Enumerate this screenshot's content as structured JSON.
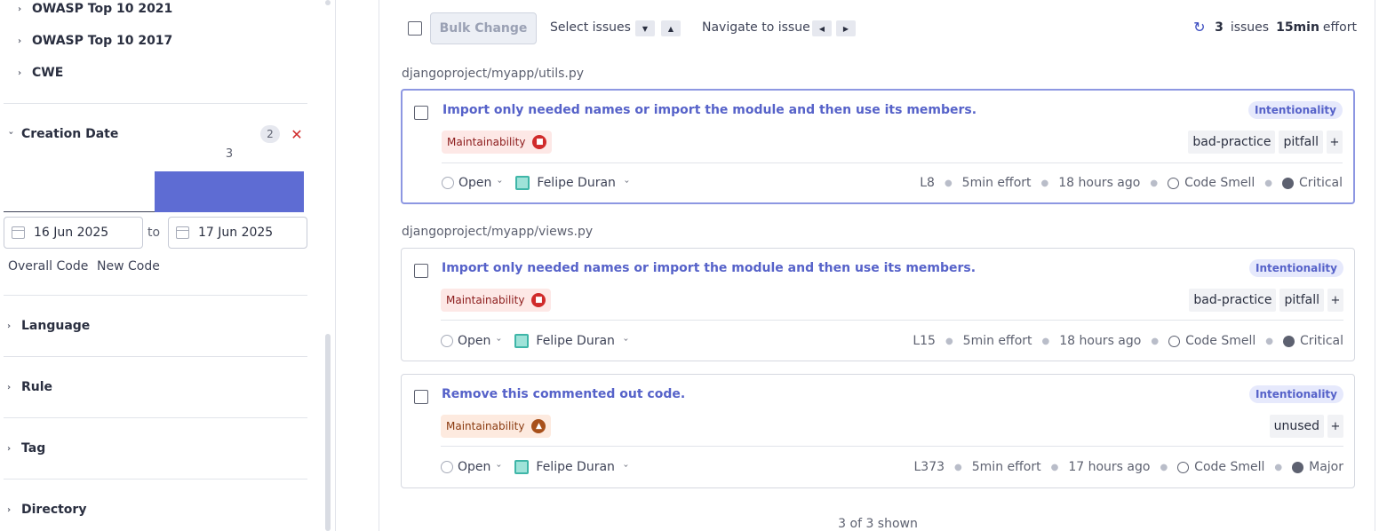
{
  "sidebar": {
    "standards": [
      "OWASP Top 10 2021",
      "OWASP Top 10 2017",
      "CWE"
    ],
    "creation_date": {
      "title": "Creation Date",
      "count": "2",
      "bar_value": "3",
      "from": "16 Jun 2025",
      "to_label": "to",
      "to": "17 Jun 2025",
      "overall_code": "Overall Code",
      "new_code": "New Code"
    },
    "facets": [
      "Language",
      "Rule",
      "Tag",
      "Directory"
    ]
  },
  "toolbar": {
    "bulk_change": "Bulk Change",
    "select_issues": "Select issues",
    "navigate": "Navigate to issue",
    "issues_count": "3",
    "issues_label": "issues",
    "effort_value": "15min",
    "effort_label": "effort"
  },
  "groups": [
    {
      "path": "djangoproject/myapp/utils.py",
      "issues": [
        {
          "title": "Import only needed names or import the module and then use its members.",
          "category": "Intentionality",
          "quality": "Maintainability",
          "tags": [
            "bad-practice",
            "pitfall",
            "+"
          ],
          "status": "Open",
          "assignee": "Felipe Duran",
          "line": "L8",
          "effort": "5min effort",
          "age": "18 hours ago",
          "type": "Code Smell",
          "severity": "Critical"
        }
      ]
    },
    {
      "path": "djangoproject/myapp/views.py",
      "issues": [
        {
          "title": "Import only needed names or import the module and then use its members.",
          "category": "Intentionality",
          "quality": "Maintainability",
          "tags": [
            "bad-practice",
            "pitfall",
            "+"
          ],
          "status": "Open",
          "assignee": "Felipe Duran",
          "line": "L15",
          "effort": "5min effort",
          "age": "18 hours ago",
          "type": "Code Smell",
          "severity": "Critical"
        },
        {
          "title": "Remove this commented out code.",
          "category": "Intentionality",
          "quality": "Maintainability",
          "tags": [
            "unused",
            "+"
          ],
          "status": "Open",
          "assignee": "Felipe Duran",
          "line": "L373",
          "effort": "5min effort",
          "age": "17 hours ago",
          "type": "Code Smell",
          "severity": "Major"
        }
      ]
    }
  ],
  "footer": {
    "shown": "3 of 3 shown"
  },
  "colors": {
    "accent": "#5662c9",
    "histogram": "#5e6cd3",
    "critical": "#d02b2b",
    "major": "#a8501a"
  }
}
